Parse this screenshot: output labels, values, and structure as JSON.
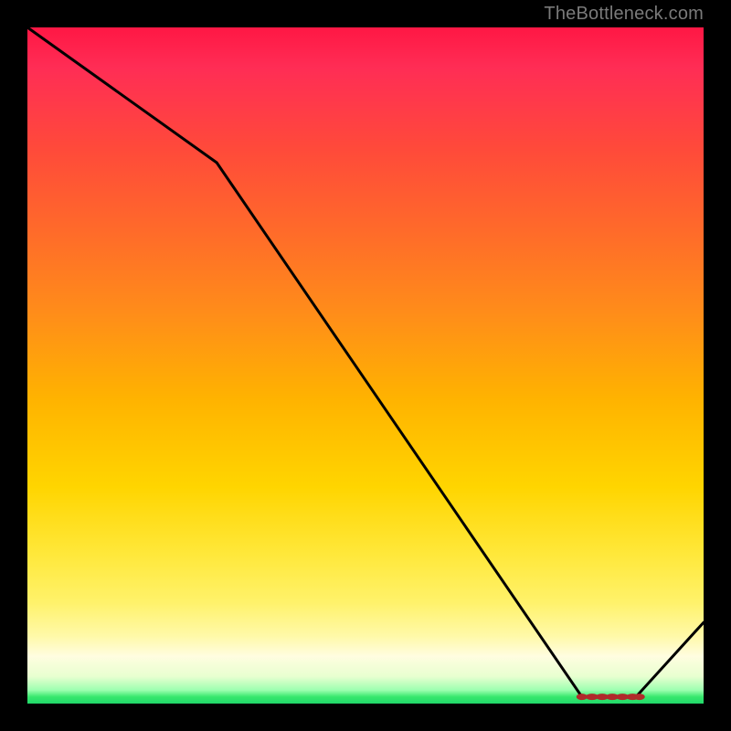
{
  "watermark": "TheBottleneck.com",
  "chart_data": {
    "type": "line",
    "title": "",
    "xlabel": "",
    "ylabel": "",
    "xlim": [
      0,
      100
    ],
    "ylim": [
      0,
      100
    ],
    "grid": false,
    "legend": false,
    "series": [
      {
        "name": "curve",
        "x": [
          0,
          28,
          82,
          90,
          100
        ],
        "y": [
          100,
          80,
          1,
          1,
          12
        ],
        "color": "#000000"
      }
    ],
    "markers": {
      "name": "flat-segment",
      "color": "#b02a2a",
      "points": [
        {
          "x": 82.0,
          "y": 1.0
        },
        {
          "x": 83.5,
          "y": 1.0
        },
        {
          "x": 85.0,
          "y": 1.0
        },
        {
          "x": 86.5,
          "y": 1.0
        },
        {
          "x": 88.0,
          "y": 1.0
        },
        {
          "x": 89.5,
          "y": 1.0
        },
        {
          "x": 90.5,
          "y": 1.0
        }
      ]
    },
    "note": "Values estimated from pixels; axes not labeled in source image."
  }
}
